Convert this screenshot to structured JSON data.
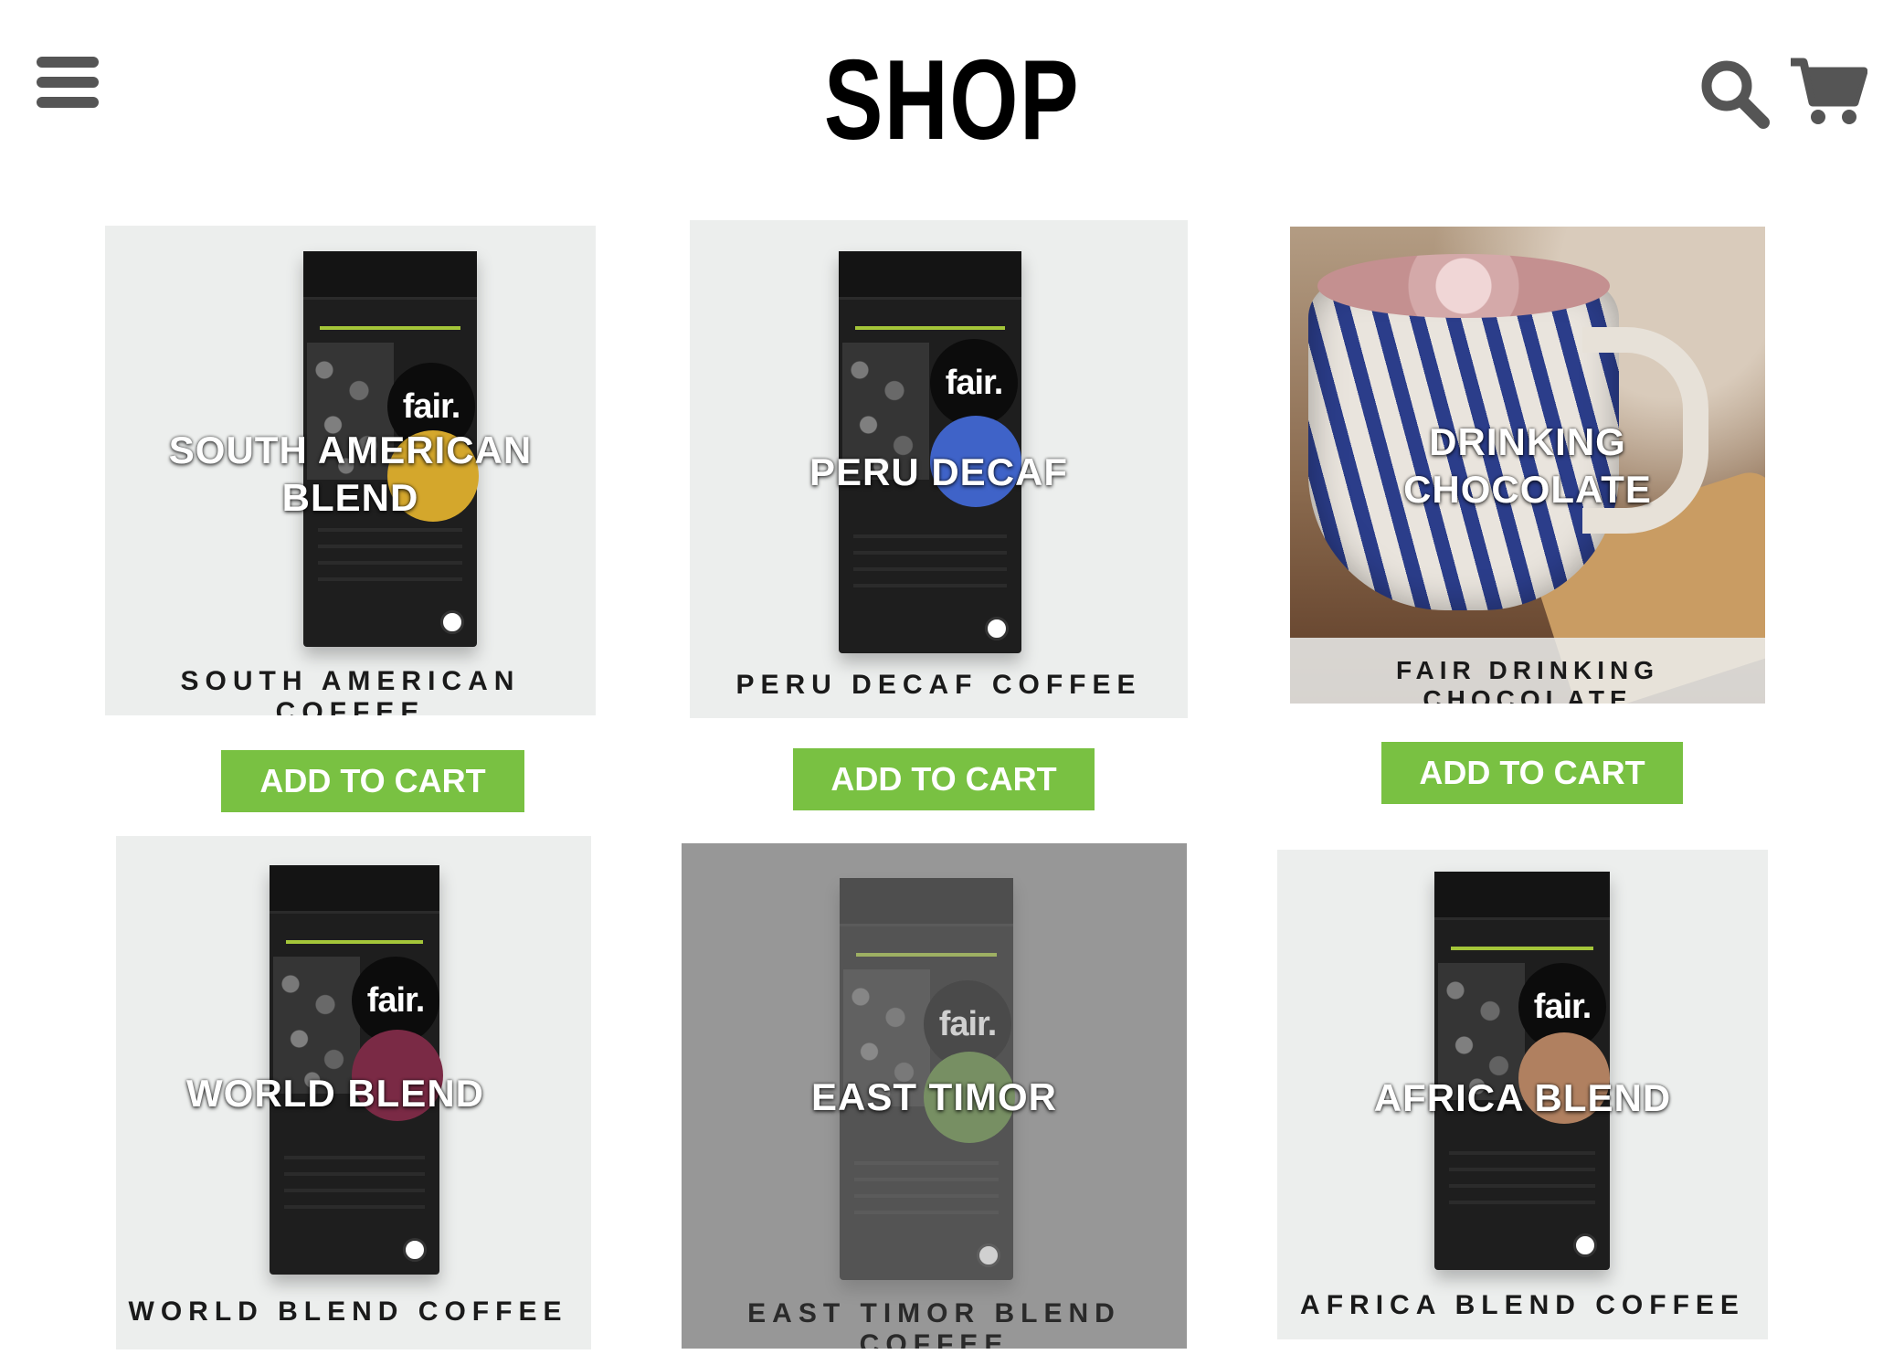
{
  "header": {
    "title": "SHOP"
  },
  "products": [
    {
      "overlay": "SOUTH AMERICAN BLEND",
      "caption": "SOUTH AMERICAN COFFEE",
      "button": "ADD TO CART",
      "flavor_color": "#d4a72c"
    },
    {
      "overlay": "PERU DECAF",
      "caption": "PERU DECAF COFFEE",
      "button": "ADD TO CART",
      "flavor_color": "#3f63c8"
    },
    {
      "overlay": "DRINKING CHOCOLATE",
      "caption": "FAIR DRINKING CHOCOLATE",
      "button": "ADD TO CART"
    },
    {
      "overlay": "WORLD BLEND",
      "caption": "WORLD BLEND COFFEE",
      "flavor_color": "#7a2a45"
    },
    {
      "overlay": "EAST TIMOR",
      "caption": "EAST TIMOR BLEND COFFEE",
      "flavor_color": "#5e8a3a"
    },
    {
      "overlay": "AFRICA BLEND",
      "caption": "AFRICA BLEND COFFEE",
      "flavor_color": "#b08060"
    }
  ],
  "pack_badge": "fair.",
  "colors": {
    "accent_green": "#79c142",
    "card_bg": "#eceeed",
    "icon_gray": "#555555"
  },
  "icons": [
    "hamburger-menu-icon",
    "search-icon",
    "cart-icon"
  ]
}
